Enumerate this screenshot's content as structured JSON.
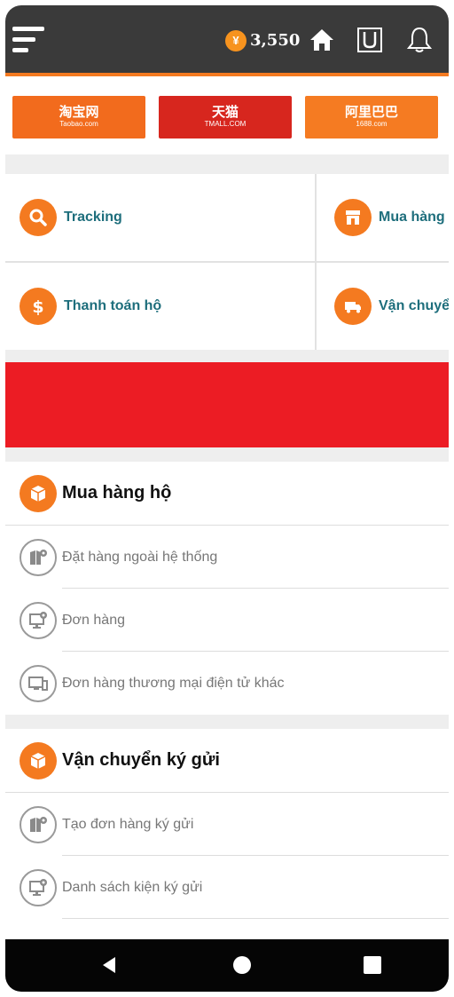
{
  "header": {
    "coin_symbol": "¥",
    "coin_amount": "3,550",
    "icons": [
      "menu-icon",
      "home-icon",
      "cart-icon",
      "bell-icon"
    ]
  },
  "marketplaces": [
    {
      "title": "淘宝网",
      "subtitle": "Taobao.com"
    },
    {
      "title": "天猫",
      "subtitle": "TMALL.COM"
    },
    {
      "title": "阿里巴巴",
      "subtitle": "1688.com"
    }
  ],
  "services": [
    {
      "label": "Tracking",
      "icon": "search-icon"
    },
    {
      "label": "Mua hàng hộ",
      "icon": "store-icon"
    },
    {
      "label": "Thanh toán hộ",
      "icon": "dollar-icon"
    },
    {
      "label": "Vận chuyển",
      "icon": "truck-icon"
    }
  ],
  "sections": [
    {
      "title": "Mua hàng hộ",
      "items": [
        {
          "label": "Đặt hàng ngoài hệ thống",
          "icon": "map-pin-icon"
        },
        {
          "label": "Đơn hàng",
          "icon": "monitor-icon"
        },
        {
          "label": "Đơn hàng thương mại điện tử khác",
          "icon": "devices-icon"
        }
      ]
    },
    {
      "title": "Vận chuyển ký gửi",
      "items": [
        {
          "label": "Tạo đơn hàng ký gửi",
          "icon": "map-pin-icon"
        },
        {
          "label": "Danh sách kiện ký gửi",
          "icon": "monitor-icon"
        }
      ]
    }
  ],
  "colors": {
    "accent": "#f47a20",
    "header_bg": "#3a3a3a",
    "link_text": "#1e6e7c",
    "promo_red": "#ec1c24"
  }
}
